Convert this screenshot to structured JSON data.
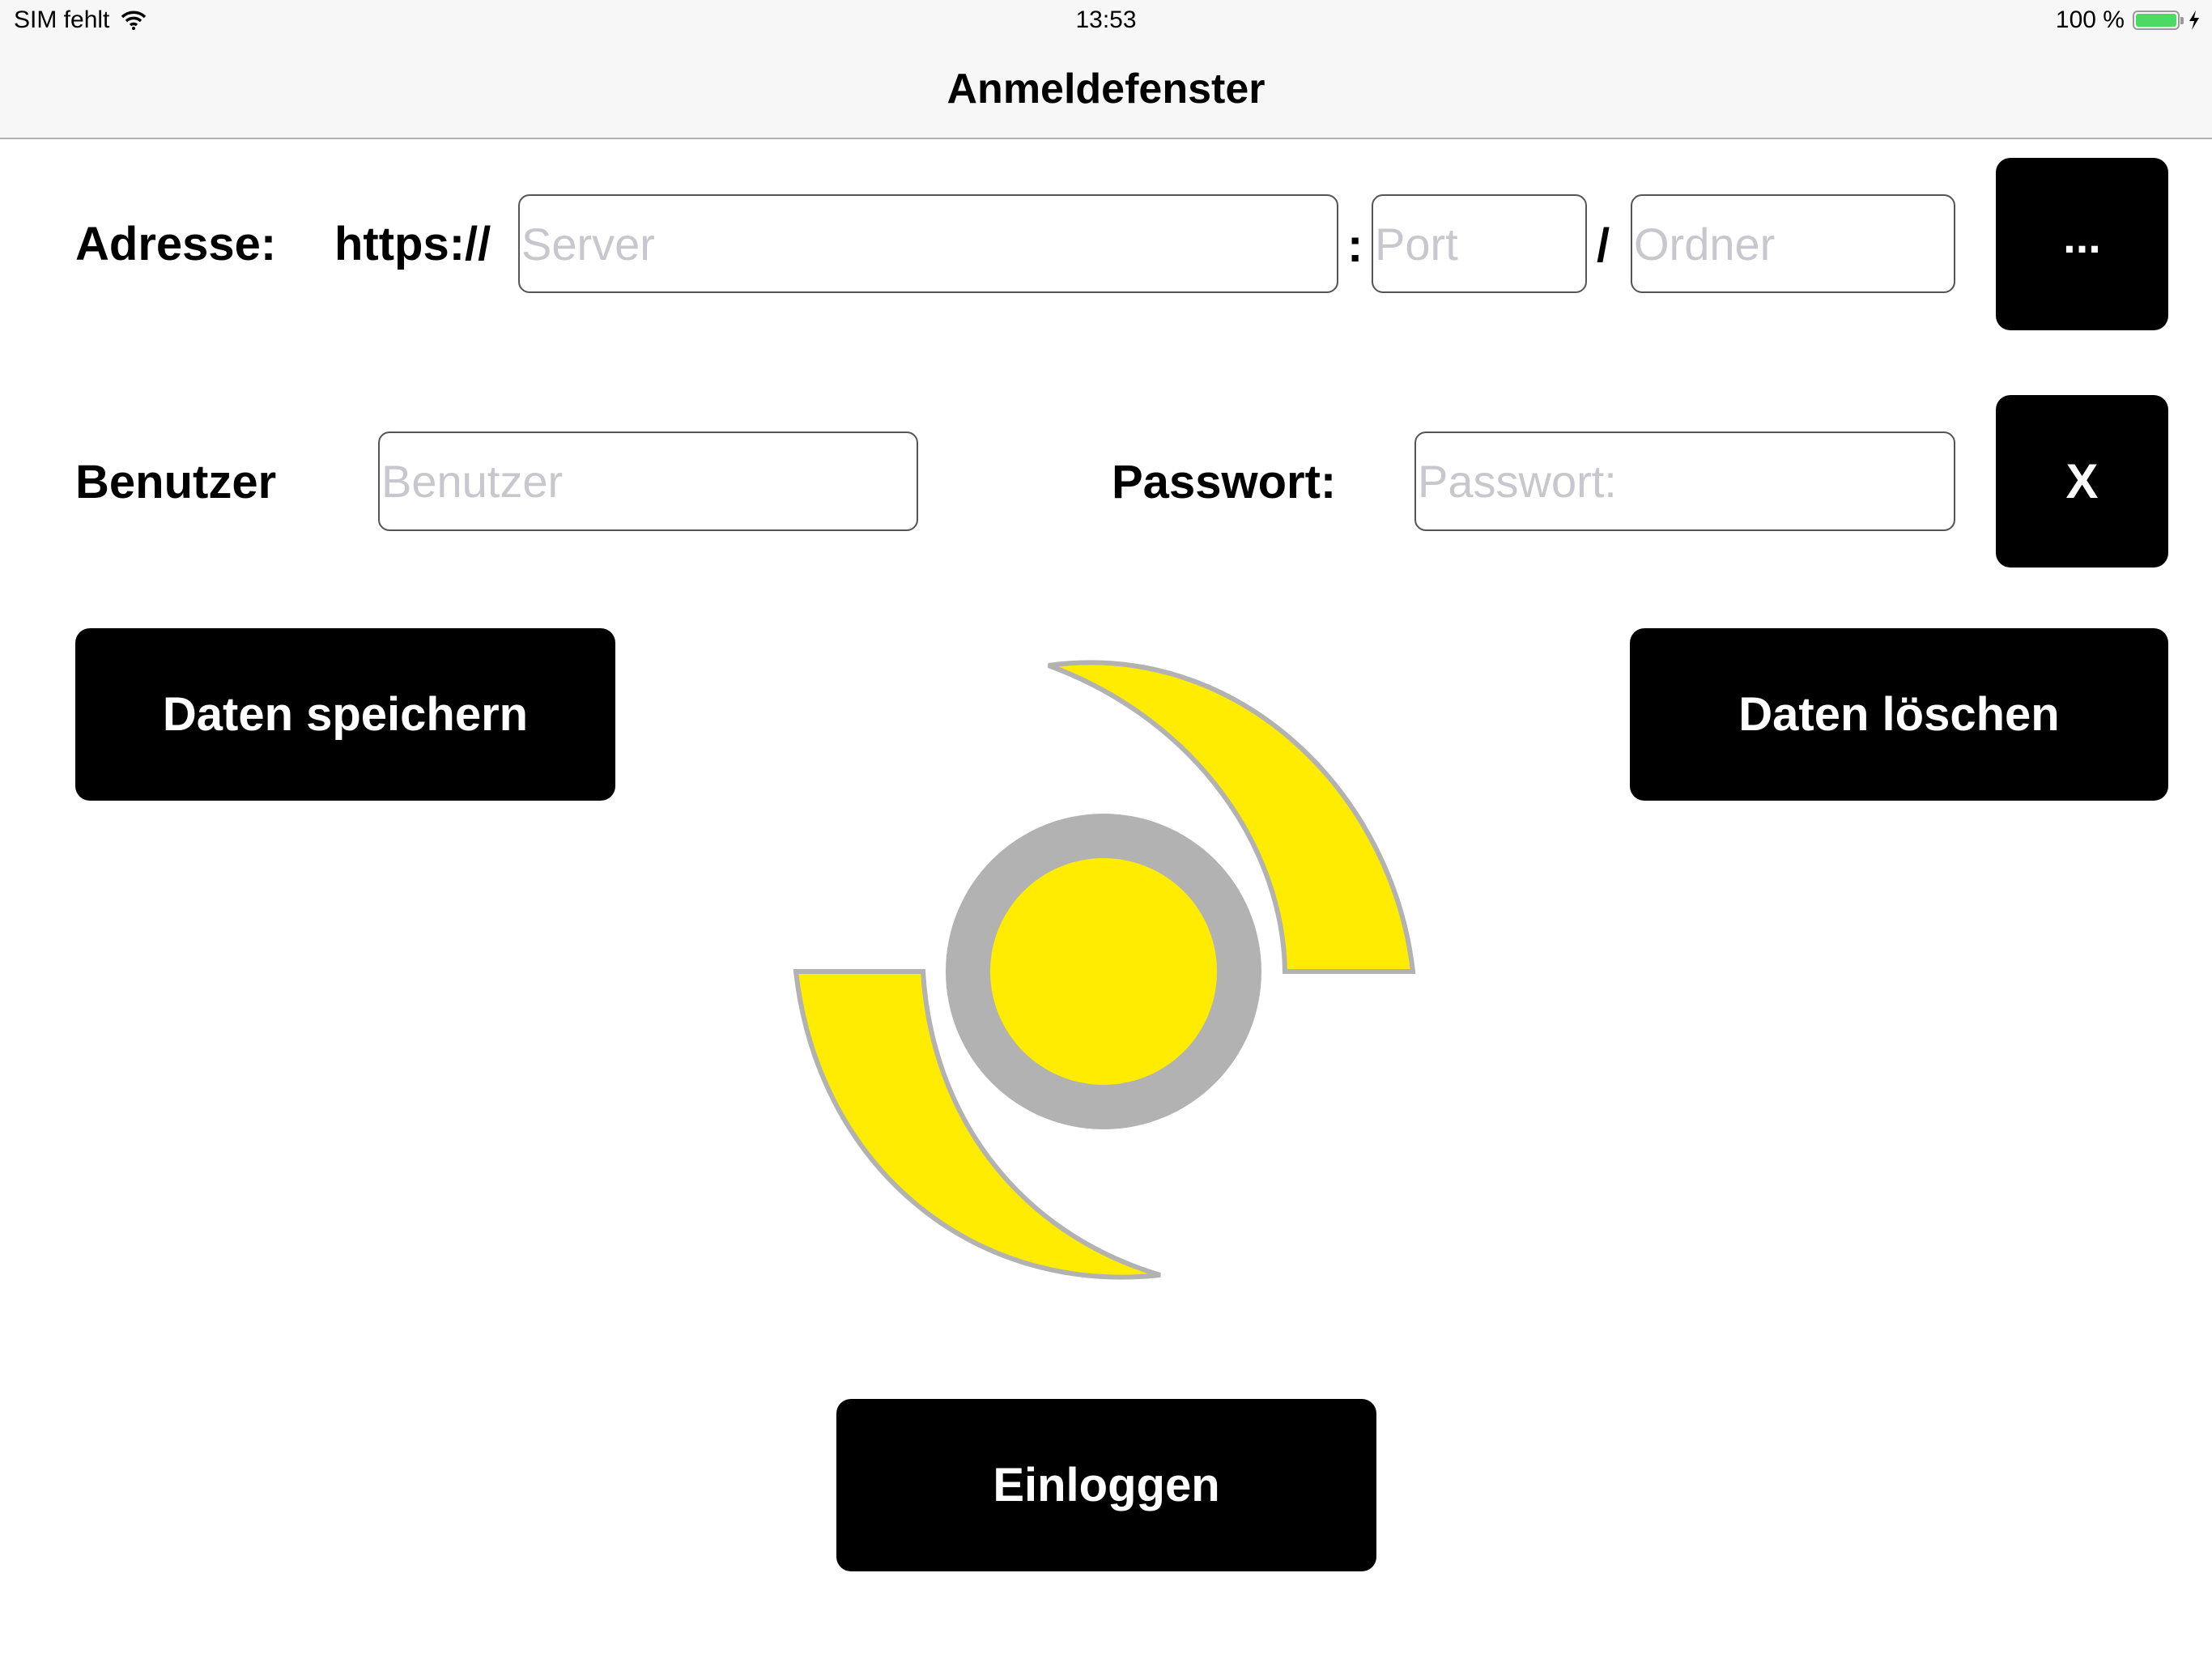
{
  "status_bar": {
    "carrier": "SIM fehlt",
    "time": "13:53",
    "battery_percent": "100 %",
    "battery_level": 1.0,
    "icons": [
      "wifi-icon",
      "battery-icon",
      "charging-bolt-icon"
    ]
  },
  "nav": {
    "title": "Anmeldefenster"
  },
  "address": {
    "label": "Adresse:",
    "scheme": "https://",
    "server_placeholder": "Server",
    "colon": ":",
    "port_placeholder": "Port",
    "slash": "/",
    "folder_placeholder": "Ordner",
    "more_button": "..."
  },
  "credentials": {
    "user_label": "Benutzer",
    "user_placeholder": "Benutzer",
    "password_label": "Passwort:",
    "password_placeholder": "Passwort:",
    "clear_button": "X"
  },
  "actions": {
    "save": "Daten speichern",
    "delete": "Daten löschen",
    "login": "Einloggen"
  },
  "logo": {
    "fill_color": "#ffec00",
    "stroke_color": "#b2b2b2"
  }
}
